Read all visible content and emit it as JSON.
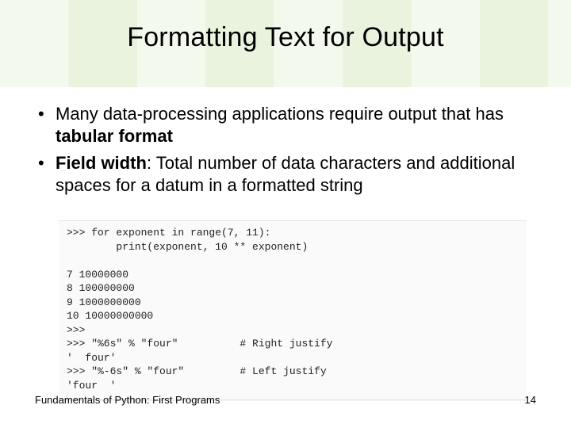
{
  "title": "Formatting Text for Output",
  "bullets": [
    {
      "pre": "Many data-processing applications require output that has ",
      "bold": "tabular format",
      "post": ""
    },
    {
      "pre": "",
      "bold": "Field width",
      "post": ": Total number of data characters and additional spaces for a datum in a formatted string"
    }
  ],
  "code": ">>> for exponent in range(7, 11):\n        print(exponent, 10 ** exponent)\n\n7 10000000\n8 100000000\n9 1000000000\n10 10000000000\n>>>\n>>> \"%6s\" % \"four\"          # Right justify\n'  four'\n>>> \"%-6s\" % \"four\"         # Left justify\n'four  '",
  "footer": {
    "left": "Fundamentals of Python: First Programs",
    "right": "14"
  }
}
